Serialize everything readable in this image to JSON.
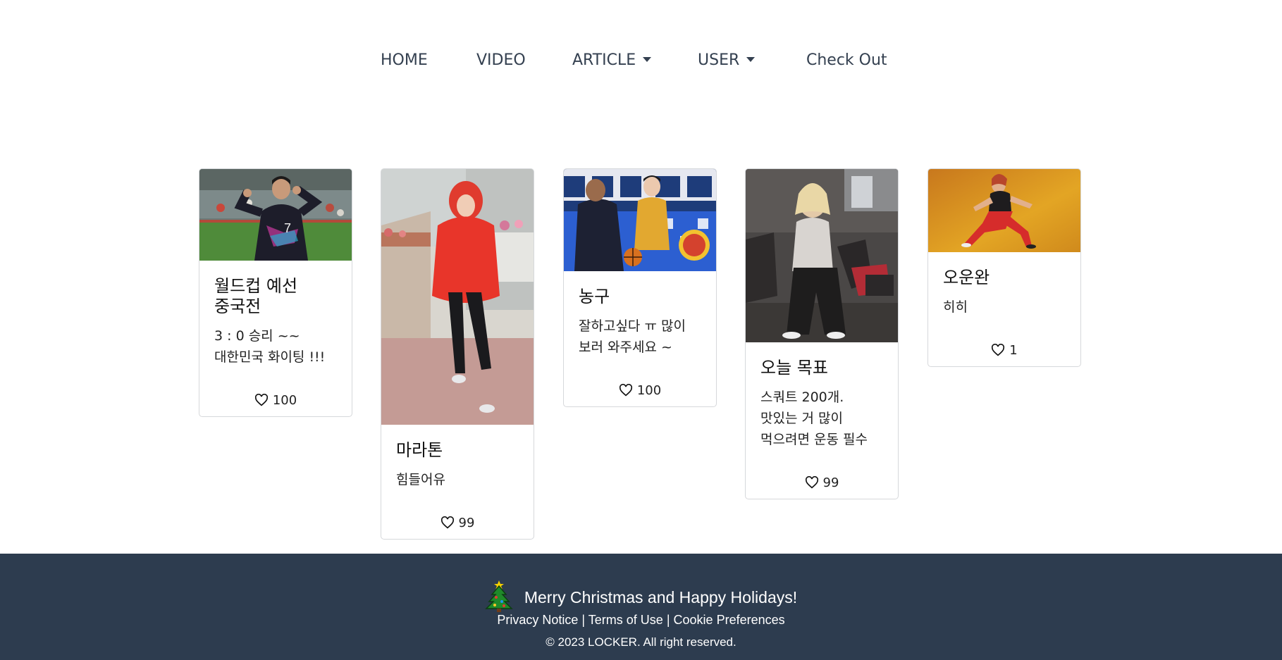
{
  "nav": {
    "home": "HOME",
    "video": "VIDEO",
    "article": "ARTICLE",
    "user": "USER",
    "checkout": "Check Out"
  },
  "cards": [
    {
      "title": "월드컵 예선 중국전",
      "text": "3 : 0 승리 ~~ 대한민국 화이팅 !!!",
      "likes": "100",
      "image": "soccer-player-photo"
    },
    {
      "title": "마라톤",
      "text": "힘들어유",
      "likes": "99",
      "image": "runner-photo"
    },
    {
      "title": "농구",
      "text": "잘하고싶다 ㅠ 많이 보러 와주세요 ~",
      "likes": "100",
      "image": "basketball-photo"
    },
    {
      "title": "오늘 목표",
      "text": "스쿼트 200개. 맛있는 거 많이 먹으려면 운동 필수",
      "likes": "99",
      "image": "gym-photo"
    },
    {
      "title": "오운완",
      "text": "히히",
      "likes": "1",
      "image": "fitness-photo"
    }
  ],
  "footer": {
    "message": "Merry Christmas and Happy Holidays!",
    "privacy": "Privacy Notice",
    "terms": "Terms of Use",
    "cookies": "Cookie Preferences",
    "separator": "|",
    "copyright": "© 2023 LOCKER. All right reserved."
  },
  "colors": {
    "footer_bg": "#2d3c4f",
    "nav_text": "#344050"
  }
}
